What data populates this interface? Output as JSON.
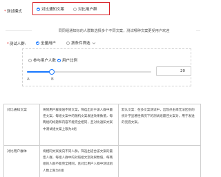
{
  "test_mode": {
    "label": "测试模式",
    "required_mark": "*",
    "options": [
      {
        "label": "对比通知文案",
        "selected": true
      },
      {
        "label": "对比用户群",
        "selected": false
      }
    ]
  },
  "description": "同同组通知标的人群数选择多个不同文案，测试哪种文案更受用户欢迎",
  "population": {
    "label": "测试人群:",
    "required_mark": "*",
    "options": [
      {
        "label": "全量用户",
        "selected": true
      },
      {
        "label": "按条件筛选",
        "selected": false,
        "chevron": "chevron-down-icon"
      }
    ],
    "split_mode": {
      "options": [
        {
          "label": "参与用户人数",
          "selected": false
        },
        {
          "label": "用户比例",
          "selected": true
        }
      ]
    },
    "slider": {
      "value_percent": 20,
      "accent": "#1677ff"
    },
    "group_labels": [
      "A",
      "B"
    ],
    "input_value": "20"
  },
  "table": {
    "rows": [
      {
        "name": "对比通知文案",
        "mechanism": "将同用户群发送不同文案，筛选出对于该人群中最佳文案，每组文案中的随机文案发送效果数值，每两组的标题和内容不能完全相同，且对比通知文案中测试组文案上限为4组",
        "note": "默认文案：在多文案测试中，出现点击率无法区别的统计学显著性情况下的测试组最佳文案对，用于发送的兜底文案。"
      },
      {
        "name": "对比用户群体",
        "mechanism": "将相同文案发向不同人群，筛选出适合该文案的最佳人群，每组人群中的对照组文案效果数值，每两组的人群不能完全相同，且对比用户人群中测试组人数上限为4组",
        "note": ""
      }
    ]
  }
}
